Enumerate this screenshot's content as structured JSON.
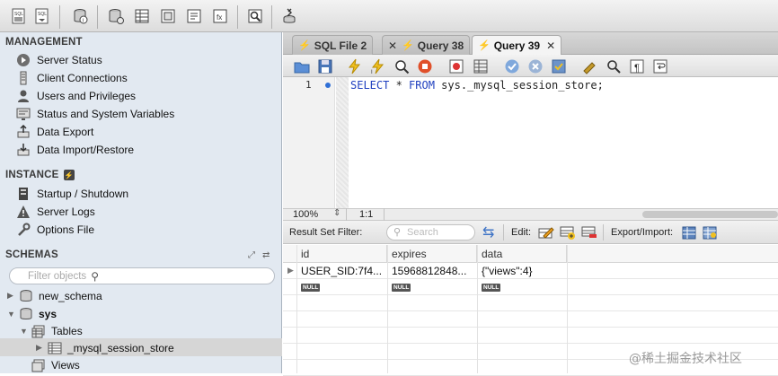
{
  "sidebar": {
    "management_header": "MANAGEMENT",
    "management_items": [
      "Server Status",
      "Client Connections",
      "Users and Privileges",
      "Status and System Variables",
      "Data Export",
      "Data Import/Restore"
    ],
    "instance_header": "INSTANCE",
    "instance_items": [
      "Startup / Shutdown",
      "Server Logs",
      "Options File"
    ],
    "schemas_header": "SCHEMAS",
    "filter_placeholder": "Filter objects",
    "tree": {
      "new_schema": "new_schema",
      "sys": "sys",
      "tables": "Tables",
      "table_item": "_mysql_session_store",
      "views": "Views"
    }
  },
  "tabs": [
    {
      "label": "SQL File 2"
    },
    {
      "label": "Query 38"
    },
    {
      "label": "Query 39",
      "active": true
    }
  ],
  "editor": {
    "line_number": "1",
    "sql_keyword_select": "SELECT",
    "sql_star": " * ",
    "sql_keyword_from": "FROM",
    "sql_rest": " sys._mysql_session_store;"
  },
  "status": {
    "zoom": "100%",
    "position": "1:1"
  },
  "result_toolbar": {
    "filter_label": "Result Set Filter:",
    "search_placeholder": "Search",
    "edit_label": "Edit:",
    "export_label": "Export/Import:"
  },
  "grid": {
    "columns": [
      "id",
      "expires",
      "data"
    ],
    "rows": [
      [
        "USER_SID:7f4...",
        "15968812848...",
        "{\"views\":4}"
      ]
    ],
    "null_label": "NULL"
  },
  "watermark": "@稀土掘金技术社区",
  "colors": {
    "sidebar_bg": "#e2e9f1",
    "sql_keyword": "#1f3fbf",
    "selected_row": "#d6d6d6"
  }
}
